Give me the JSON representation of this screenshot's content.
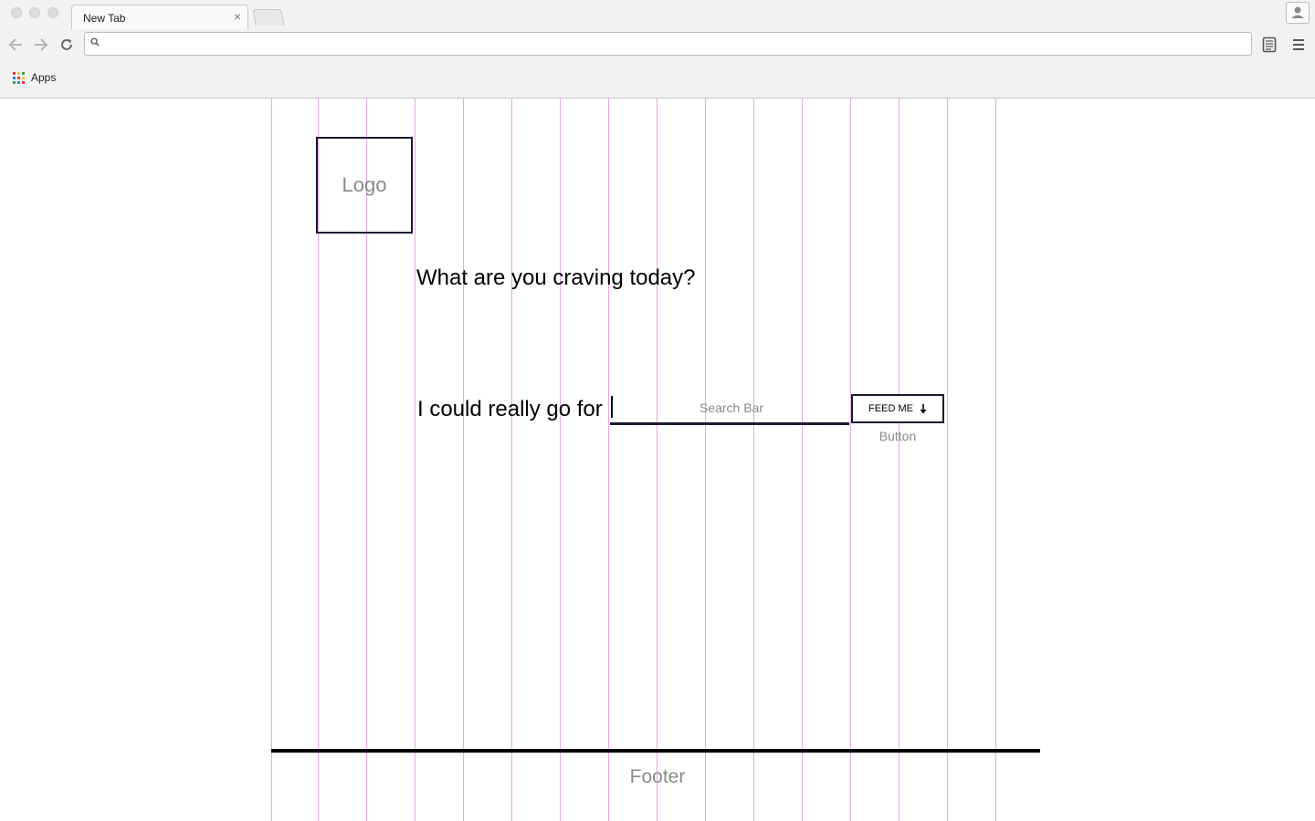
{
  "browser": {
    "tab": {
      "title": "New Tab",
      "close_symbol": "×"
    },
    "omnibox": {
      "value": "",
      "placeholder": ""
    },
    "bookmarks": [
      {
        "label": "Apps",
        "icon": "apps-grid-icon"
      }
    ],
    "icons": {
      "back": "back-arrow-icon",
      "forward": "forward-arrow-icon",
      "reload": "reload-icon",
      "reader": "reader-icon",
      "menu": "menu-icon",
      "profile": "profile-icon"
    }
  },
  "page": {
    "logo_label": "Logo",
    "heading": "What are you craving today?",
    "prompt": "I could really go for",
    "search": {
      "value": "",
      "placeholder": "Search Bar"
    },
    "button": {
      "label": "FEED ME",
      "icon": "arrow-down-icon",
      "caption": "Button"
    },
    "footer": {
      "label": "Footer"
    }
  },
  "colors": {
    "grid_overlay": "#e9a5e9",
    "border_dark": "#1a1a2e",
    "placeholder_gray": "#8a8a8a",
    "chrome_bg": "#f2f2f2"
  }
}
